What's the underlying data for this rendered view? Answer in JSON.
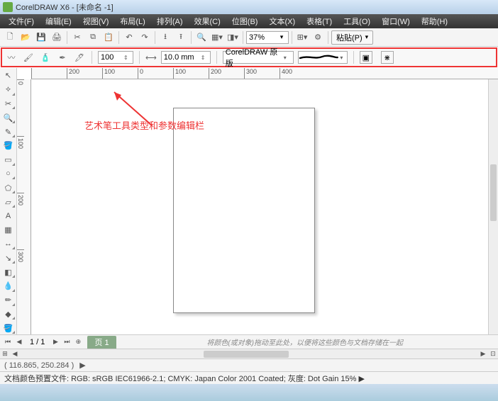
{
  "title": "CorelDRAW X6 - [未命名 -1]",
  "menu": [
    "文件(F)",
    "编辑(E)",
    "视图(V)",
    "布局(L)",
    "排列(A)",
    "效果(C)",
    "位图(B)",
    "文本(X)",
    "表格(T)",
    "工具(O)",
    "窗口(W)",
    "帮助(H)"
  ],
  "zoom": "37%",
  "paste": "粘贴(P)",
  "prop": {
    "smooth": "100",
    "width": "10.0 mm",
    "preset": "CorelDRAW 原版"
  },
  "ruler_h": [
    "",
    "200",
    "100",
    "0",
    "100",
    "200",
    "300",
    "400"
  ],
  "ruler_v": [
    "0",
    "",
    "100",
    "",
    "200",
    "",
    "300",
    ""
  ],
  "annotation": "艺术笔工具类型和参数编辑栏",
  "page_nav": {
    "current": "1",
    "total": "1",
    "tab": "页 1"
  },
  "hint": "将颜色(或对象)拖动至此处，以便将这些颜色与文档存储在一起",
  "status": {
    "coords": "( 116.865, 250.284 )"
  },
  "color_profile": "文档颜色预置文件: RGB: sRGB IEC61966-2.1; CMYK: Japan Color 2001 Coated; 灰度: Dot Gain 15% ▶"
}
